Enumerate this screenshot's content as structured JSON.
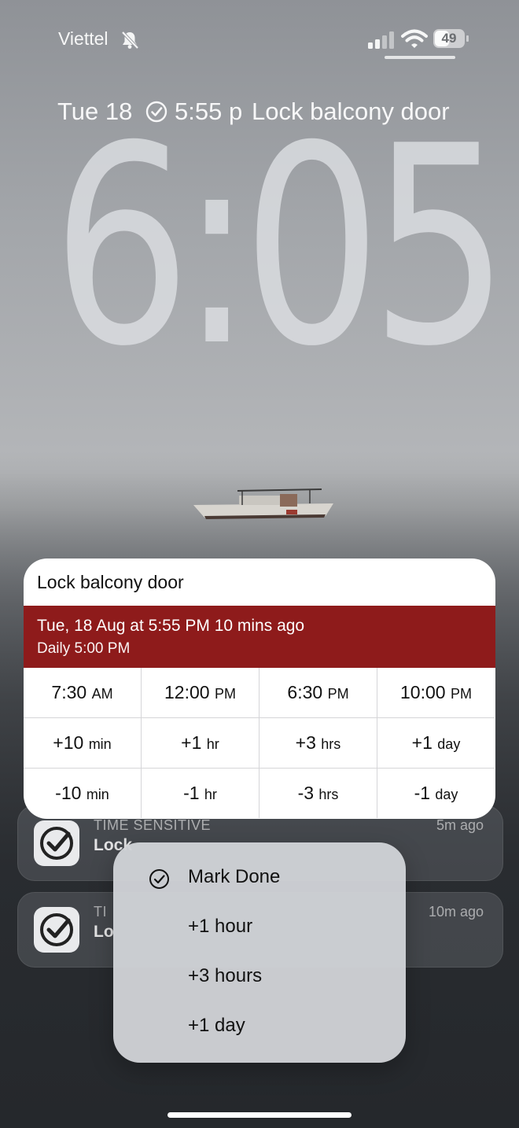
{
  "status_bar": {
    "carrier": "Viettel",
    "battery": "49",
    "icons": [
      "bell-slash-icon",
      "signal-icon",
      "wifi-icon",
      "battery-icon"
    ]
  },
  "lock_screen": {
    "date": "Tue 18",
    "reminder_time": "5:55 p",
    "reminder_title": "Lock balcony door",
    "clock": "6:05"
  },
  "reminder_card": {
    "title": "Lock balcony door",
    "due_line": "Tue, 18 Aug at 5:55 PM 10 mins ago",
    "repeat_line": "Daily 5:00 PM",
    "accent_color": "#8e1b1b",
    "rows": [
      [
        {
          "value": "7:30",
          "unit": "AM"
        },
        {
          "value": "12:00",
          "unit": "PM"
        },
        {
          "value": "6:30",
          "unit": "PM"
        },
        {
          "value": "10:00",
          "unit": "PM"
        }
      ],
      [
        {
          "value": "+10",
          "unit": "min"
        },
        {
          "value": "+1",
          "unit": "hr"
        },
        {
          "value": "+3",
          "unit": "hrs"
        },
        {
          "value": "+1",
          "unit": "day"
        }
      ],
      [
        {
          "value": "-10",
          "unit": "min"
        },
        {
          "value": "-1",
          "unit": "hr"
        },
        {
          "value": "-3",
          "unit": "hrs"
        },
        {
          "value": "-1",
          "unit": "day"
        }
      ]
    ]
  },
  "notifications": [
    {
      "category": "TIME SENSITIVE",
      "title": "Lock",
      "time": "5m ago"
    },
    {
      "category": "TI",
      "title": "Lo",
      "time": "10m ago"
    }
  ],
  "action_menu": {
    "items": [
      {
        "label": "Mark Done",
        "icon": "checkmark-circle-icon"
      },
      {
        "label": "+1 hour"
      },
      {
        "label": "+3 hours"
      },
      {
        "label": "+1 day"
      }
    ]
  }
}
